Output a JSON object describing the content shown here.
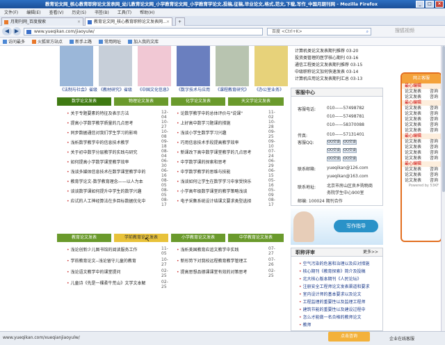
{
  "window": {
    "title": "教育论文网_核心教育职称论文发表网_幼儿教育论文网_小学教育论文网_小学教育学论文,投稿,征稿,毕业论文,格式,范文,下载,写作_中国月期刊网 - Mozilla Firefox",
    "minimize": "_",
    "maximize": "□",
    "close": "×"
  },
  "menu": [
    "文件(F)",
    "编辑(E)",
    "查看(V)",
    "历史(S)",
    "书签(B)",
    "工具(T)",
    "帮助(H)"
  ],
  "tabs": [
    {
      "label": "月期刊网_百度搜索"
    },
    {
      "label": "教育论文网_核心教育职称论文发表网..."
    }
  ],
  "nav": {
    "url": "www.yueqikan.com/jiaoyulw/",
    "search_placeholder": "百度 <Ctrl+K>",
    "watermark": "搜狐视频"
  },
  "bookmarks": [
    "访问最多",
    "火狐官方站点",
    "新手上路",
    "常用网址",
    "加入我的文库"
  ],
  "magazines": [
    {
      "label": "《法制与社会》省级",
      "color": "#9bb7d9"
    },
    {
      "label": "《教材研究》省级",
      "color": "#c7cfd9"
    },
    {
      "label": "《中国文化信息》",
      "color": "#f1c8d4"
    },
    {
      "label": "《数字技术与应用",
      "color": "#6a7fbf"
    },
    {
      "label": "《课程教育研究》",
      "color": "#b8c4b0"
    },
    {
      "label": "《办公室业务》",
      "color": "#e7d27a"
    }
  ],
  "tabs_top": [
    "数学论文发表",
    "物理论文发表",
    "化学论文发表",
    "天文学论文发表"
  ],
  "list_left": [
    {
      "t": "关于专题要素的特征及表示方法",
      "d": "12-04"
    },
    {
      "t": "提高小学数学教学质量的几点思考",
      "d": "10-27"
    },
    {
      "t": "同步数据通信对我们学生学习的影响",
      "d": "10-08"
    },
    {
      "t": "浅析数学教学中的信息技术教学",
      "d": "09-18"
    },
    {
      "t": "关于初中数学分层教学的实践与研究",
      "d": "08-04"
    },
    {
      "t": "如何提高小学数学课堂教学效率",
      "d": "06-30"
    },
    {
      "t": "浅谈多媒体信息技术在数学课堂教学中的",
      "d": "06-16"
    },
    {
      "t": "教育学论文-数学教育理念——以人为本",
      "d": "08-05"
    },
    {
      "t": "谈谈数学课如何提升中学生的数学兴趣",
      "d": "08-05"
    },
    {
      "t": "应试的人工神经算法在多目标数据优化中",
      "d": "08-17"
    }
  ],
  "list_right": [
    {
      "t": "论数学教学中的总体评价与\"说课\"",
      "d": "11-02"
    },
    {
      "t": "上好高中数学习题课的措施",
      "d": "10-28"
    },
    {
      "t": "浅谈小学生数学学习兴趣",
      "d": "09-25"
    },
    {
      "t": "巧用信息技术手段提高教学效率",
      "d": "09-10"
    },
    {
      "t": "新课改下高中数学课堂教学的几点思考",
      "d": "07-24"
    },
    {
      "t": "中学数学课的探索和思考",
      "d": "06-29"
    },
    {
      "t": "中学数学教学的思维与技能",
      "d": "06-15"
    },
    {
      "t": "浅谈如何让学生在数学学习中享受快乐",
      "d": "05-16"
    },
    {
      "t": "小学高年级数学课堂的教学策略浅谈",
      "d": "05-09"
    },
    {
      "t": "电子采集系统设计结课文要求类型选择",
      "d": "08-17"
    }
  ],
  "tabs_bottom": [
    "教育论文发表",
    "学前教育论文发表",
    "小学教育论文发表",
    "中学教育论文发表"
  ],
  "list2_left": [
    {
      "t": "浅论创新少儿图书馆的阅读服务工作",
      "d": "11-05"
    },
    {
      "t": "学前教育论文--浅论留守儿童的教育",
      "d": "10-27"
    },
    {
      "t": "浅论语文教学中的课堂提问",
      "d": "02-25"
    },
    {
      "t": "儿童诗《先是一棵柔牛荒山》文学文本解",
      "d": "02-25"
    }
  ],
  "list2_right": [
    {
      "t": "浅析美国教育应追文教学中实践",
      "d": "07-27"
    },
    {
      "t": "新形势下对我校远程教育教学管理工",
      "d": "07-26"
    },
    {
      "t": "提高思想品德课课堂有效的对策思考",
      "d": "02-25"
    }
  ],
  "right_top_list": [
    {
      "t": "计算机类论文发表期刊推荐",
      "d": "03-20"
    },
    {
      "t": "投资类管理的医学核心期刊",
      "d": "03-16"
    },
    {
      "t": "通信工程类论文发表期刊推荐",
      "d": "03-15"
    },
    {
      "t": "中级职称论文加何快速发表",
      "d": "03-14"
    },
    {
      "t": "计算机应用论文发表期刊汇总",
      "d": "03-13"
    }
  ],
  "customer": {
    "title": "客服中心",
    "phone_label": "客服电话:",
    "phones": [
      "010——57498782",
      "010——57498781",
      "010——58370088"
    ],
    "fax_label": "传真:",
    "fax": "010——57131401",
    "qq_label": "客服QQ:",
    "qq_text": "QQ交谈",
    "email_label": "联系邮箱:",
    "emails": [
      "yueqikan@126.com",
      "yueqikan@163.com"
    ],
    "address_label": "联系地址:",
    "address": [
      "北京市房山区良乡购物商",
      "务院学生中心900室"
    ],
    "postcode": "邮编: 100024 期刊合作"
  },
  "banner_text": "写作指导",
  "hot": {
    "title": "职称评审",
    "more": "更多>>",
    "items": [
      "空气污染的危害和治理以及应对措施",
      "核心期刊《教育探索》简介及投稿",
      "北大核心版本期刊《人民论坛》",
      "注册安全工程师论文发表渠道和要求",
      "室内设计师的基本要求以及论文",
      "工程监理的重要性以及监理工程师",
      "建筑节能的重要性以及建设过程中",
      "怎么才能做一名合格的教师论文",
      "教师"
    ]
  },
  "float_panel": {
    "head": "网上客服",
    "sections": [
      {
        "name": "最心编辑",
        "rows": [
          [
            "论文发表",
            "咨询"
          ],
          [
            "论文发表",
            "咨询"
          ]
        ]
      },
      {
        "name": "最心编辑",
        "rows": [
          [
            "论文发表",
            "咨询"
          ],
          [
            "论文发表",
            "咨询"
          ],
          [
            "论文发表",
            "咨询"
          ],
          [
            "论文发表",
            "咨询"
          ],
          [
            "论文发表",
            "咨询"
          ]
        ]
      },
      {
        "name": "最心编辑",
        "rows": [
          [
            "论文发表",
            "咨询"
          ],
          [
            "论文发表",
            "咨询"
          ],
          [
            "论文发表",
            "咨询"
          ],
          [
            "论文发表",
            "咨询"
          ]
        ]
      },
      {
        "name": "最心编辑",
        "rows": [
          [
            "论文发表",
            "咨询"
          ],
          [
            "论文发表",
            "咨询"
          ],
          [
            "论文发表",
            "咨询"
          ]
        ]
      }
    ],
    "foot": "Powered by 53KF"
  },
  "status": {
    "url": "www.yueqikan.com/xueqianjiaoyulw/",
    "online": "点击咨询",
    "enterprise": "企业在线客服"
  }
}
